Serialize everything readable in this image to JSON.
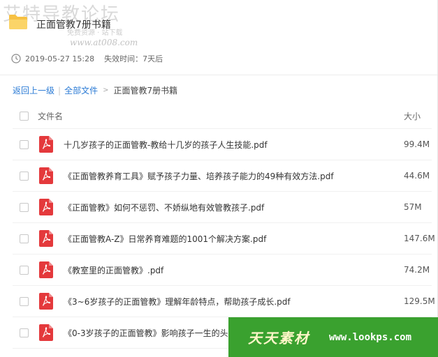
{
  "watermark": {
    "title": "艾特导教论坛",
    "subtitle": "免费资源 · 站下载",
    "url": "www.at008.com"
  },
  "share": {
    "title": "正面管教7册书籍",
    "date": "2019-05-27 15:28",
    "expiry": "失效时间：7天后"
  },
  "breadcrumb": {
    "back": "返回上一级",
    "all": "全部文件",
    "current": "正面管教7册书籍"
  },
  "table": {
    "header_name": "文件名",
    "header_size": "大小",
    "files": [
      {
        "name": "十几岁孩子的正面管教-教给十几岁的孩子人生技能.pdf",
        "size": "99.4M"
      },
      {
        "name": "《正面管教养育工具》赋予孩子力量、培养孩子能力的49种有效方法.pdf",
        "size": "44.6M"
      },
      {
        "name": "《正面管教》如何不惩罚、不娇纵地有效管教孩子.pdf",
        "size": "57M"
      },
      {
        "name": "《正面管教A-Z》日常养育难题的1001个解决方案.pdf",
        "size": "147.6M"
      },
      {
        "name": "《教室里的正面管教》.pdf",
        "size": "74.2M"
      },
      {
        "name": "《3~6岁孩子的正面管教》理解年龄特点，帮助孩子成长.pdf",
        "size": "129.5M"
      },
      {
        "name": "《0-3岁孩子的正面管教》影响孩子一生的头",
        "size": ""
      }
    ]
  },
  "banner": {
    "logo": "天天素材",
    "url": "www.lookps.com"
  },
  "colors": {
    "link": "#2b7bd5",
    "pdf_red": "#e4393c",
    "folder_yellow": "#f7c143",
    "banner_green": "#3aa12f"
  },
  "icons": {
    "folder": "folder-icon",
    "clock": "clock-icon",
    "pdf": "pdf-file-icon"
  }
}
